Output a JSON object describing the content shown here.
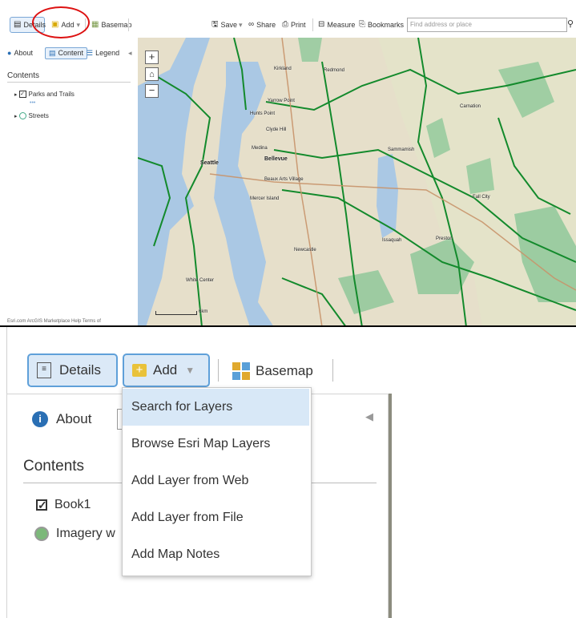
{
  "top": {
    "toolbar": {
      "details": "Details",
      "add": "Add",
      "basemap": "Basemap",
      "save": "Save",
      "share": "Share",
      "print": "Print",
      "measure": "Measure",
      "bookmarks": "Bookmarks",
      "search_placeholder": "Find address or place"
    },
    "tabs": {
      "about": "About",
      "content": "Content",
      "legend": "Legend"
    },
    "contents_title": "Contents",
    "layers": [
      "Parks and Trails",
      "Streets"
    ],
    "footer": "Esri.com   ArcGIS Marketplace   Help   Terms of",
    "map": {
      "labels": [
        {
          "text": "Seattle",
          "cls": ""
        },
        {
          "text": "Bellevue",
          "cls": ""
        },
        {
          "text": "Kirkland",
          "cls": "small"
        },
        {
          "text": "Redmond",
          "cls": "small"
        },
        {
          "text": "Sammamish",
          "cls": "small"
        },
        {
          "text": "Issaquah",
          "cls": "small"
        },
        {
          "text": "Newcastle",
          "cls": "small"
        },
        {
          "text": "Medina",
          "cls": "small"
        },
        {
          "text": "Clyde Hill",
          "cls": "small"
        },
        {
          "text": "Hunts Point",
          "cls": "small"
        },
        {
          "text": "Yarrow Point",
          "cls": "small"
        },
        {
          "text": "Mercer Island",
          "cls": "small"
        },
        {
          "text": "Beaux Arts Village",
          "cls": "small"
        },
        {
          "text": "Preston",
          "cls": "small"
        },
        {
          "text": "Fall City",
          "cls": "small"
        },
        {
          "text": "Carnation",
          "cls": "small"
        },
        {
          "text": "White Center",
          "cls": "small"
        }
      ],
      "scale": "6km"
    }
  },
  "bottom": {
    "toolbar": {
      "details": "Details",
      "add": "Add",
      "basemap": "Basemap"
    },
    "about": "About",
    "contents_title": "Contents",
    "layers": [
      "Book1",
      "Imagery w"
    ],
    "dropdown": [
      "Search for Layers",
      "Browse Esri Map Layers",
      "Add Layer from Web",
      "Add Layer from File",
      "Add Map Notes"
    ]
  },
  "colors": {
    "accent_border": "#5fa0d9",
    "accent_fill": "#dbe9f7",
    "highlight": "#d8e8f7",
    "water": "#aac8e4",
    "park": "#8fc89a",
    "trail": "#138a2c",
    "circle": "#dd1111"
  }
}
